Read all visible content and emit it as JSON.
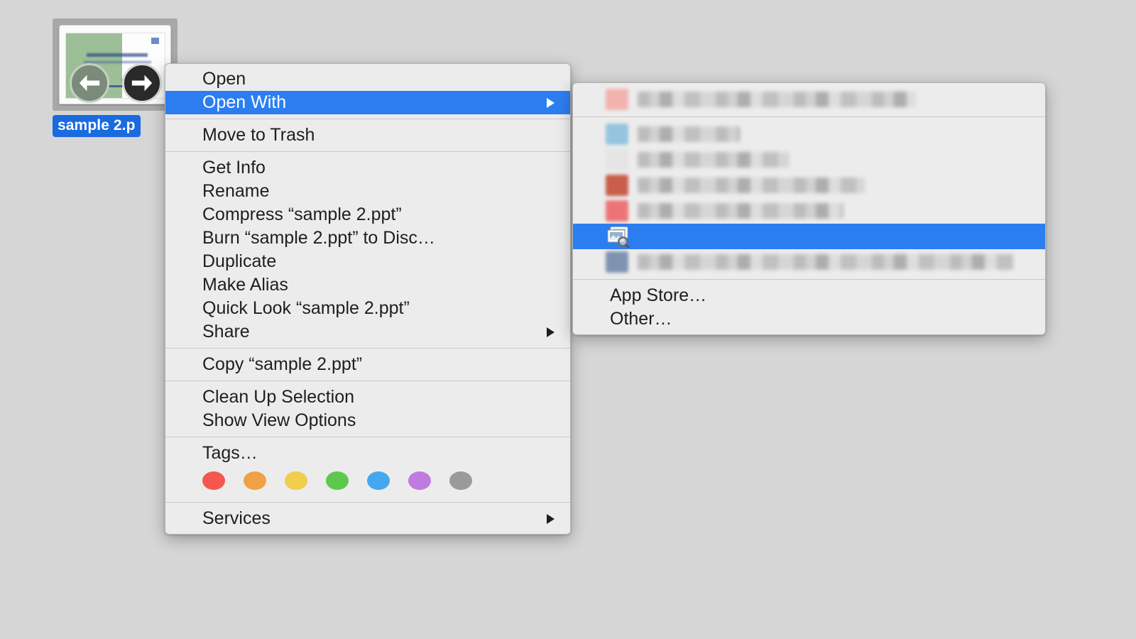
{
  "desktop": {
    "background_color": "#d6d6d6",
    "file": {
      "name_label": "sample 2.p",
      "full_name": "sample 2.ppt",
      "icon_name": "powerpoint-slide-thumbnail",
      "label_selected_color": "#1a6ae0"
    }
  },
  "context_menu": {
    "name": "finder-context-menu",
    "highlight_color": "#2c7ef0",
    "background_color": "#ececec",
    "groups": [
      {
        "items": [
          {
            "label": "Open",
            "has_submenu": false,
            "selected": false
          },
          {
            "label": "Open With",
            "has_submenu": true,
            "selected": true
          }
        ]
      },
      {
        "items": [
          {
            "label": "Move to Trash",
            "has_submenu": false,
            "selected": false
          }
        ]
      },
      {
        "items": [
          {
            "label": "Get Info",
            "has_submenu": false,
            "selected": false
          },
          {
            "label": "Rename",
            "has_submenu": false,
            "selected": false
          },
          {
            "label": "Compress “sample 2.ppt”",
            "has_submenu": false,
            "selected": false
          },
          {
            "label": "Burn “sample 2.ppt” to Disc…",
            "has_submenu": false,
            "selected": false
          },
          {
            "label": "Duplicate",
            "has_submenu": false,
            "selected": false
          },
          {
            "label": "Make Alias",
            "has_submenu": false,
            "selected": false
          },
          {
            "label": "Quick Look “sample 2.ppt”",
            "has_submenu": false,
            "selected": false
          },
          {
            "label": "Share",
            "has_submenu": true,
            "selected": false
          }
        ]
      },
      {
        "items": [
          {
            "label": "Copy “sample 2.ppt”",
            "has_submenu": false,
            "selected": false
          }
        ]
      },
      {
        "items": [
          {
            "label": "Clean Up Selection",
            "has_submenu": false,
            "selected": false
          },
          {
            "label": "Show View Options",
            "has_submenu": false,
            "selected": false
          }
        ]
      },
      {
        "items": [
          {
            "label": "Tags…",
            "has_submenu": false,
            "selected": false
          }
        ]
      },
      {
        "items": [
          {
            "label": "Services",
            "has_submenu": true,
            "selected": false
          }
        ]
      }
    ],
    "tags": [
      {
        "name": "red",
        "color": "#f4574f"
      },
      {
        "name": "orange",
        "color": "#f0a045"
      },
      {
        "name": "yellow",
        "color": "#f0cd4a"
      },
      {
        "name": "green",
        "color": "#5ec84e"
      },
      {
        "name": "blue",
        "color": "#45a8ef"
      },
      {
        "name": "purple",
        "color": "#c munged"
      },
      {
        "name": "gray",
        "color": "#9a9a9a"
      }
    ],
    "tag_colors": [
      "#f4574f",
      "#f0a045",
      "#f0cd4a",
      "#5ec84e",
      "#45a8ef",
      "#c07be0",
      "#9a9a9a"
    ]
  },
  "open_with_submenu": {
    "name": "open-with-submenu",
    "default_app_group": [
      {
        "label": "",
        "redacted": true,
        "icon_color": "#f4a9a3"
      }
    ],
    "apps": [
      {
        "label": "",
        "redacted": true,
        "icon_color": "#86bede"
      },
      {
        "label": "",
        "redacted": true,
        "icon_color": "#e3e3e3"
      },
      {
        "label": "",
        "redacted": true,
        "icon_color": "#c4462f"
      },
      {
        "label": "",
        "redacted": true,
        "icon_color": "#ef5f63"
      },
      {
        "label": "Preview",
        "redacted": false,
        "icon_name": "preview-app-icon",
        "selected": true
      },
      {
        "label": "",
        "redacted": true,
        "icon_color": "#6e83a8"
      }
    ],
    "footer_items": [
      {
        "label": "App Store…"
      },
      {
        "label": "Other…"
      }
    ]
  }
}
